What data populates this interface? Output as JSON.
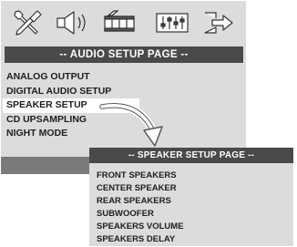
{
  "icons": [
    {
      "name": "wrench-screwdriver-icon"
    },
    {
      "name": "speaker-icon"
    },
    {
      "name": "film-icon"
    },
    {
      "name": "equalizer-icon"
    },
    {
      "name": "exit-icon"
    }
  ],
  "main_menu": {
    "title": "-- AUDIO SETUP PAGE --",
    "items": [
      {
        "label": "ANALOG OUTPUT"
      },
      {
        "label": "DIGITAL AUDIO SETUP"
      },
      {
        "label": "SPEAKER SETUP",
        "selected": true
      },
      {
        "label": "CD UPSAMPLING"
      },
      {
        "label": "NIGHT MODE"
      }
    ]
  },
  "sub_menu": {
    "title": "-- SPEAKER SETUP PAGE --",
    "items": [
      {
        "label": "FRONT SPEAKERS"
      },
      {
        "label": "CENTER SPEAKER"
      },
      {
        "label": "REAR SPEAKERS"
      },
      {
        "label": "SUBWOOFER"
      },
      {
        "label": "SPEAKERS VOLUME"
      },
      {
        "label": "SPEAKERS DELAY"
      }
    ]
  },
  "colors": {
    "panel_bg": "#dcdcdc",
    "title_bar": "#4a4a4a",
    "footer": "#7a7a7a",
    "selected_bg": "#ffffff",
    "text": "#1e1e1e"
  }
}
